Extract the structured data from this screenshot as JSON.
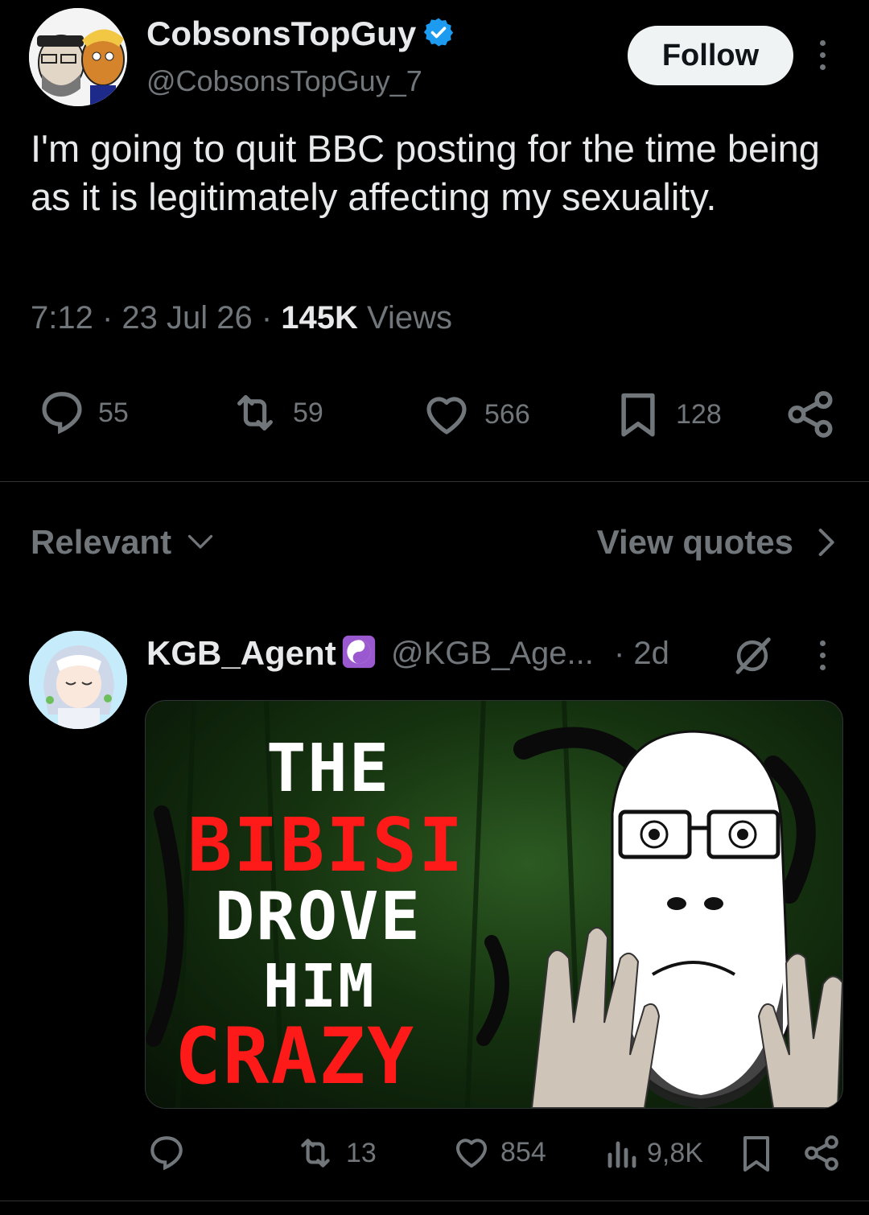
{
  "tweet": {
    "author_name": "CobsonsTopGuy",
    "author_handle": "@CobsonsTopGuy_7",
    "follow_label": "Follow",
    "text": "I'm going to quit BBC posting for the time being as it is legitimately affecting my sexuality.",
    "time": "7:12",
    "date": "23 Jul 26",
    "views_count": "145K",
    "views_label": "Views",
    "replies": "55",
    "reposts": "59",
    "likes": "566",
    "bookmarks": "128"
  },
  "replies_header": {
    "sort_label": "Relevant",
    "view_quotes_label": "View quotes"
  },
  "reply": {
    "author_name": "KGB_Agent",
    "author_handle": "@KGB_Age...",
    "time": "2d",
    "media": {
      "line1": "THE",
      "line2": "BIBISI",
      "line3": "DROVE",
      "line4": "HIM",
      "line5": "CRAZY"
    },
    "reposts": "13",
    "likes": "854",
    "views": "9,8K"
  },
  "colors": {
    "background": "#000000",
    "text_primary": "#e7e9ea",
    "text_secondary": "#71767b",
    "verified_blue": "#1d9bf0",
    "follow_bg": "#eff3f4",
    "meme_red": "#ff1a1a"
  },
  "icons": [
    "verified-badge-icon",
    "more-icon",
    "reply-icon",
    "repost-icon",
    "like-icon",
    "bookmark-icon",
    "share-icon",
    "chevron-down-icon",
    "chevron-right-icon",
    "yin-yang-icon",
    "grok-icon",
    "views-icon"
  ]
}
